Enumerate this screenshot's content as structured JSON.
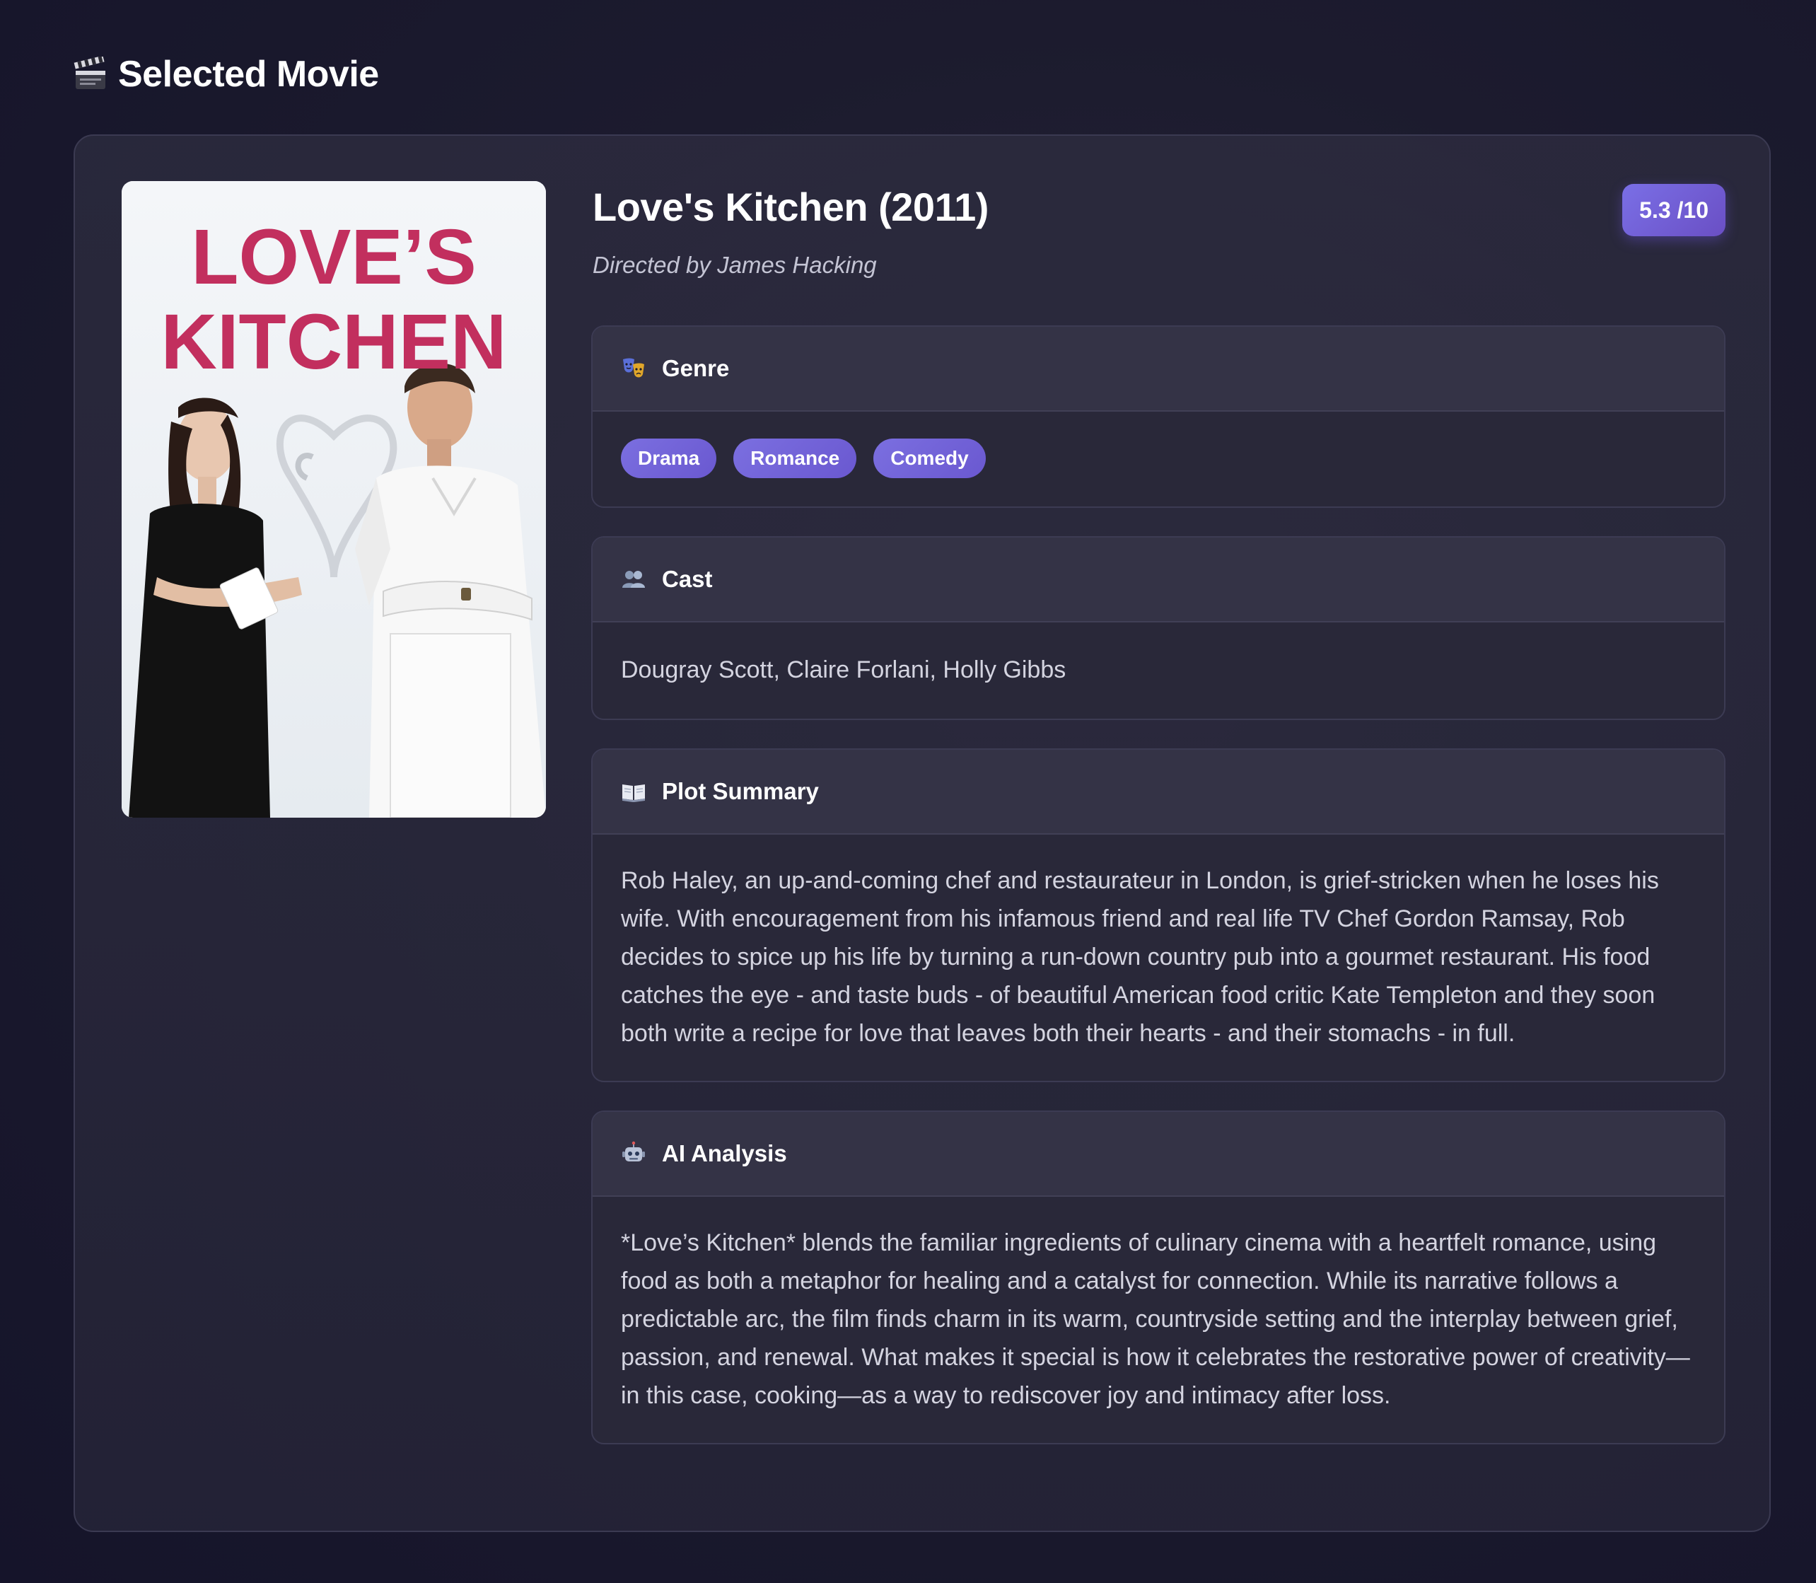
{
  "header": {
    "icon": "clapperboard-icon",
    "title": "Selected Movie"
  },
  "movie": {
    "title": "Love's Kitchen (2011)",
    "rating": "5.3 /10",
    "director": "Directed by James Hacking",
    "poster": {
      "title_line1": "LOVE’S",
      "title_line2": "KITCHEN"
    }
  },
  "sections": {
    "genre": {
      "icon": "theater-masks-icon",
      "title": "Genre",
      "tags": [
        "Drama",
        "Romance",
        "Comedy"
      ]
    },
    "cast": {
      "icon": "people-icon",
      "title": "Cast",
      "text": "Dougray Scott, Claire Forlani, Holly Gibbs"
    },
    "plot": {
      "icon": "open-book-icon",
      "title": "Plot Summary",
      "text": "Rob Haley, an up-and-coming chef and restaurateur in London, is grief-stricken when he loses his wife. With encouragement from his infamous friend and real life TV Chef Gordon Ramsay, Rob decides to spice up his life by turning a run-down country pub into a gourmet restaurant. His food catches the eye - and taste buds - of beautiful American food critic Kate Templeton and they soon both write a recipe for love that leaves both their hearts - and their stomachs - in full."
    },
    "analysis": {
      "icon": "robot-icon",
      "title": "AI Analysis",
      "text": "*Love’s Kitchen* blends the familiar ingredients of culinary cinema with a heartfelt romance, using food as both a metaphor for healing and a catalyst for connection. While its narrative follows a predictable arc, the film finds charm in its warm, countryside setting and the interplay between grief, passion, and renewal. What makes it special is how it celebrates the restorative power of creativity—in this case, cooking—as a way to rediscover joy and intimacy after loss."
    }
  },
  "colors": {
    "accent": "#7a6fe6",
    "background": "#1c1b2e",
    "poster_title": "#c22f5e"
  }
}
